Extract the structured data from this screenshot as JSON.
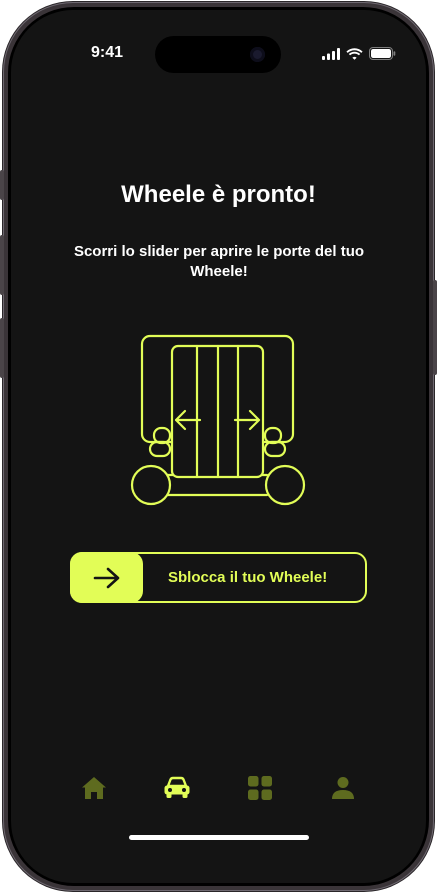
{
  "status_bar": {
    "time": "9:41",
    "icons": [
      "cellular-signal-icon",
      "wifi-icon",
      "battery-icon"
    ]
  },
  "main": {
    "title": "Wheele è pronto!",
    "subtitle": "Scorri lo slider per aprire le porte del tuo Wheele!",
    "illustration_icon": "wheele-vehicle-doors-icon"
  },
  "slider": {
    "label": "Sblocca il tuo Wheele!",
    "handle_icon": "arrow-right-icon",
    "progress": 0
  },
  "tab_bar": {
    "tabs": [
      {
        "icon": "home-icon",
        "active": false
      },
      {
        "icon": "car-icon",
        "active": true
      },
      {
        "icon": "grid-icon",
        "active": false
      },
      {
        "icon": "user-icon",
        "active": false
      }
    ]
  },
  "colors": {
    "accent": "#e2fd57",
    "background": "#141414",
    "inactive_tab": "#5e6b1f",
    "text": "#ffffff"
  }
}
